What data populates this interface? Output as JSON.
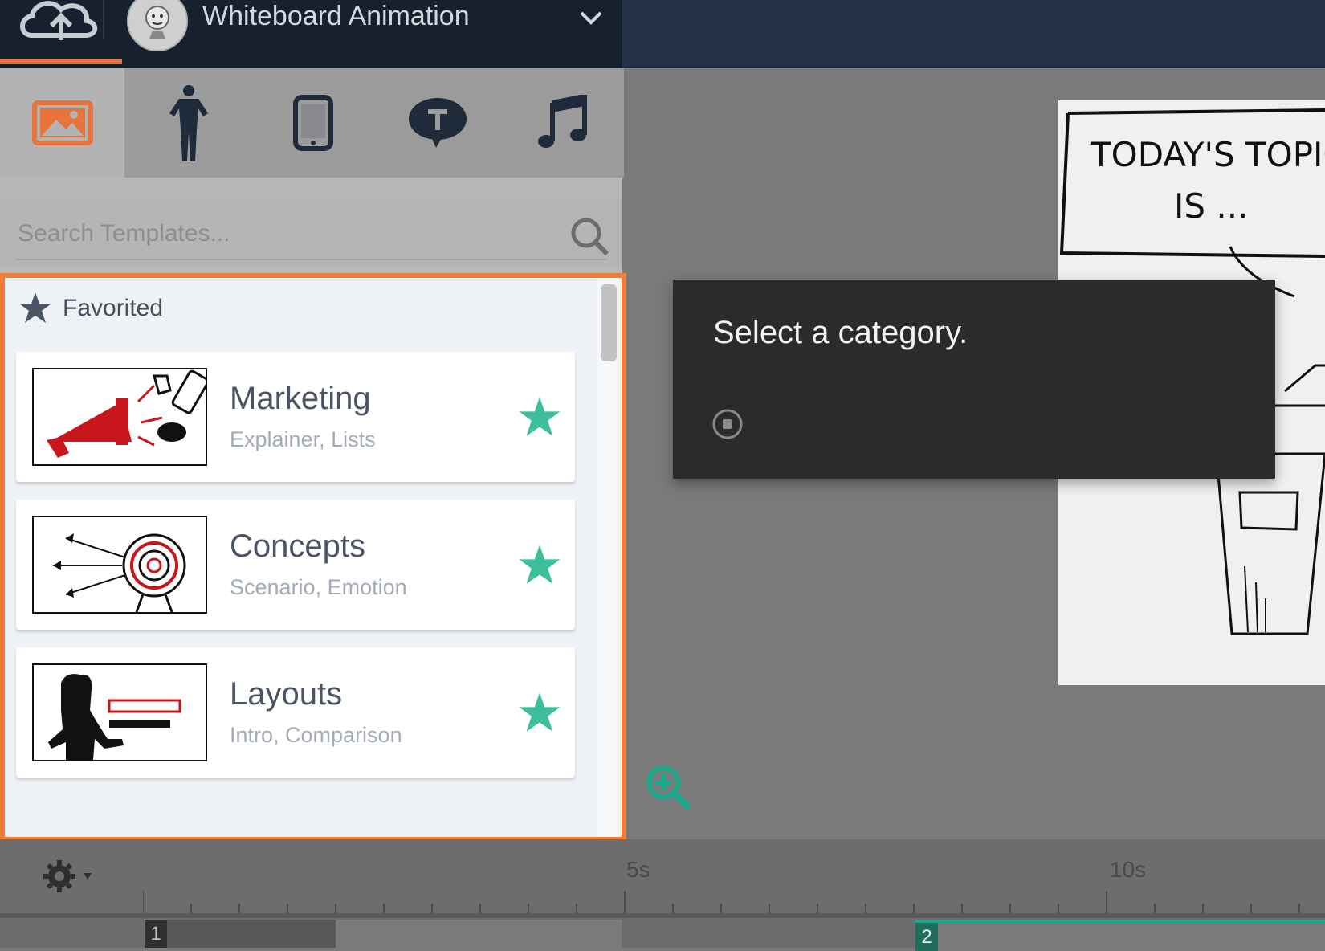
{
  "header": {
    "project_title": "Whiteboard Animation",
    "icons": {
      "upload": "cloud-upload-icon",
      "dropdown": "chevron-down-icon"
    }
  },
  "asset_tabs": [
    {
      "name": "images",
      "icon": "image-icon",
      "active": true
    },
    {
      "name": "characters",
      "icon": "person-icon",
      "active": false
    },
    {
      "name": "props",
      "icon": "phone-icon",
      "active": false
    },
    {
      "name": "text",
      "icon": "speech-bubble-text-icon",
      "active": false
    },
    {
      "name": "audio",
      "icon": "music-note-icon",
      "active": false
    }
  ],
  "search": {
    "placeholder": "Search Templates..."
  },
  "favorites": {
    "label": "Favorited",
    "items": [
      {
        "title": "Marketing",
        "subtitle": "Explainer, Lists",
        "thumbnail": "megaphone-thumbnail"
      },
      {
        "title": "Concepts",
        "subtitle": "Scenario, Emotion",
        "thumbnail": "target-thumbnail"
      },
      {
        "title": "Layouts",
        "subtitle": "Intro, Comparison",
        "thumbnail": "presenter-thumbnail"
      }
    ]
  },
  "canvas": {
    "board_text_1": "TODAY'S TOPIC",
    "board_text_2": "IS ..."
  },
  "tooltip": {
    "message": "Select a category."
  },
  "timeline": {
    "tick_labels": [
      "5s",
      "10s"
    ],
    "scenes": [
      "1",
      "2"
    ]
  },
  "colors": {
    "accent": "#f07c36",
    "teal": "#3dbf9e",
    "header": "#17202e"
  }
}
